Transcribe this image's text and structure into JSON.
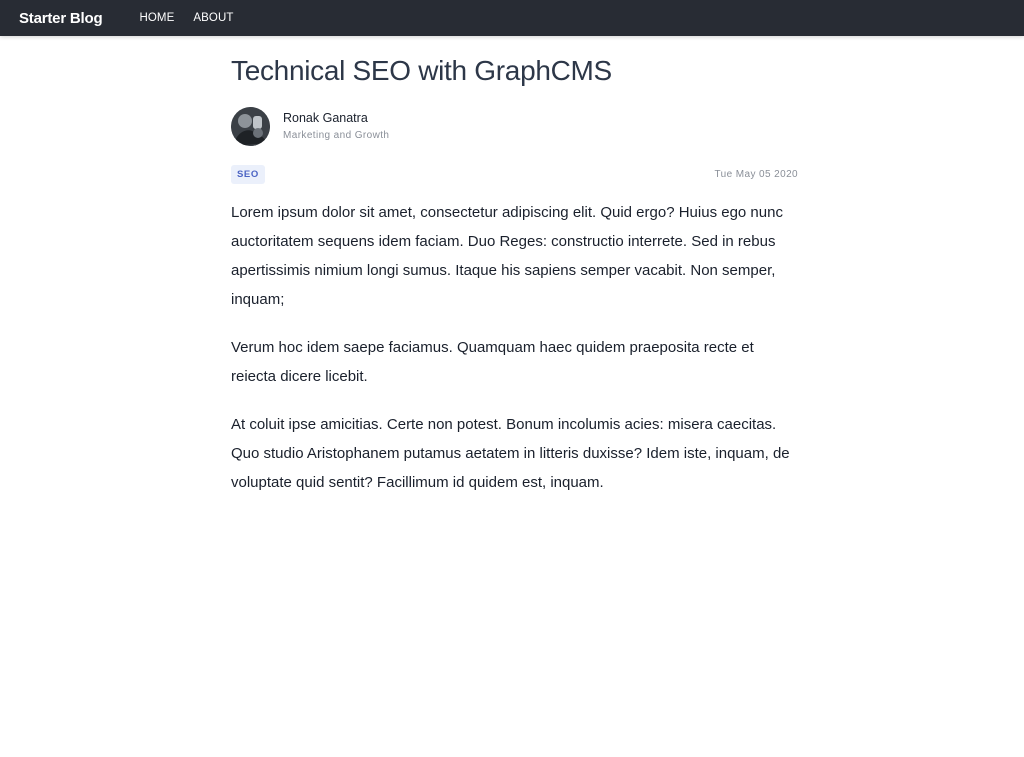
{
  "navbar": {
    "brand": "Starter Blog",
    "links": [
      {
        "label": "HOME"
      },
      {
        "label": "ABOUT"
      }
    ]
  },
  "article": {
    "title": "Technical SEO with GraphCMS",
    "author": {
      "name": "Ronak Ganatra",
      "role": "Marketing and Growth"
    },
    "tag": "SEO",
    "date": "Tue May 05 2020",
    "paragraphs": [
      "Lorem ipsum dolor sit amet, consectetur adipiscing elit. Quid ergo? Huius ego nunc auctoritatem sequens idem faciam. Duo Reges: constructio interrete. Sed in rebus apertissimis nimium longi sumus. Itaque his sapiens semper vacabit. Non semper, inquam;",
      "Verum hoc idem saepe faciamus. Quamquam haec quidem praeposita recte et reiecta dicere licebit.",
      "At coluit ipse amicitias. Certe non potest. Bonum incolumis acies: misera caecitas. Quo studio Aristophanem putamus aetatem in litteris duxisse? Idem iste, inquam, de voluptate quid sentit? Facillimum id quidem est, inquam."
    ]
  }
}
